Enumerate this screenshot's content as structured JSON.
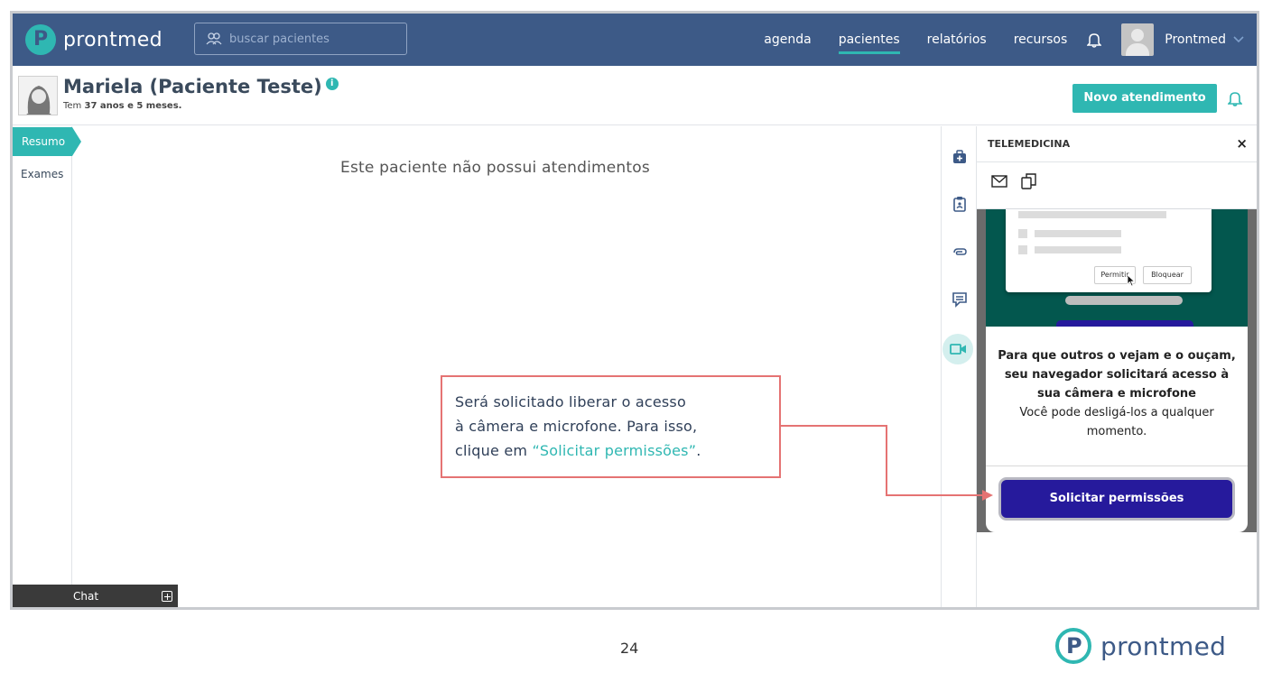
{
  "topbar": {
    "brand": "prontmed",
    "search_placeholder": "buscar pacientes",
    "nav": [
      "agenda",
      "pacientes",
      "relatórios",
      "recursos"
    ],
    "active_nav": "pacientes",
    "user_name": "Prontmed"
  },
  "patient": {
    "name": "Mariela (Paciente Teste)",
    "age_prefix": "Tem",
    "age_value": "37 anos e 5 meses.",
    "new_button": "Novo atendimento"
  },
  "left_tabs": [
    "Resumo",
    "Exames"
  ],
  "main": {
    "empty_message": "Este paciente não possui atendimentos"
  },
  "chat": {
    "label": "Chat"
  },
  "telemedicina": {
    "title": "TELEMEDICINA",
    "close_label": "×",
    "mock_allow": "Permitir",
    "mock_block": "Bloquear",
    "message_bold": "Para que outros o vejam e o ouçam, seu navegador solicitará acesso à sua câmera e microfone",
    "message_regular": "Você pode desligá-los a qualquer momento.",
    "button": "Solicitar permissões"
  },
  "callout": {
    "line1": "Será solicitado liberar o acesso",
    "line2": "à câmera e microfone. Para isso,",
    "line3_prefix": "clique em ",
    "line3_highlight": "“Solicitar permissões”",
    "line3_suffix": "."
  },
  "footer": {
    "page_number": "24",
    "brand": "prontmed"
  },
  "colors": {
    "nav_bg": "#3d5a87",
    "accent_teal": "#2fb7b2",
    "button_purple": "#261a9c",
    "callout_border": "#e57373",
    "dark_green": "#03574e"
  }
}
